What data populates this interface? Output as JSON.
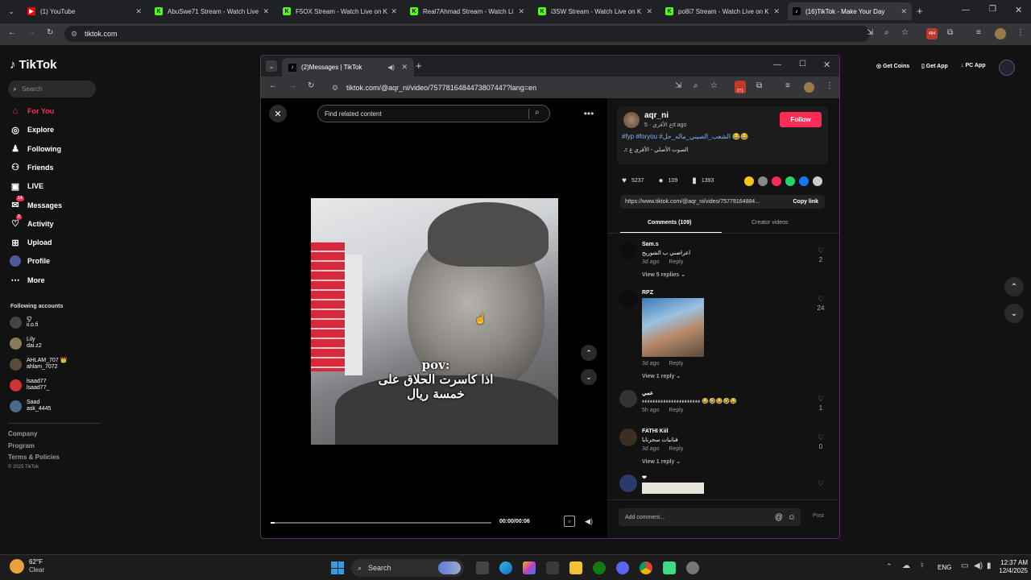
{
  "browser": {
    "tabs": [
      {
        "label": "(1) YouTube",
        "color": "#ff0000",
        "glyph": "▶"
      },
      {
        "label": "AbuSwe71 Stream - Watch Live",
        "color": "#53fc18",
        "glyph": "K"
      },
      {
        "label": "F5OX Stream - Watch Live on K",
        "color": "#53fc18",
        "glyph": "K"
      },
      {
        "label": "Real7Ahmad Stream - Watch Li",
        "color": "#53fc18",
        "glyph": "K"
      },
      {
        "label": "i3SW Stream - Watch Live on K",
        "color": "#53fc18",
        "glyph": "K"
      },
      {
        "label": "po8i7 Stream - Watch Live on K",
        "color": "#53fc18",
        "glyph": "K"
      },
      {
        "label": "(16)TikTok - Make Your Day",
        "color": "#000000",
        "glyph": "♪"
      }
    ],
    "url": "tiktok.com",
    "extension_badge": "484"
  },
  "tiktok": {
    "logo": "TikTok",
    "search_placeholder": "Search",
    "nav": [
      {
        "label": "For You",
        "icon": "home-icon",
        "active": true
      },
      {
        "label": "Explore",
        "icon": "compass-icon"
      },
      {
        "label": "Following",
        "icon": "following-icon"
      },
      {
        "label": "Friends",
        "icon": "friends-icon"
      },
      {
        "label": "LIVE",
        "icon": "live-icon"
      },
      {
        "label": "Messages",
        "icon": "messages-icon",
        "badge": "14"
      },
      {
        "label": "Activity",
        "icon": "activity-icon",
        "badge": "2"
      },
      {
        "label": "Upload",
        "icon": "upload-icon"
      },
      {
        "label": "Profile",
        "icon": "profile-icon"
      },
      {
        "label": "More",
        "icon": "more-icon"
      }
    ],
    "following_title": "Following accounts",
    "accounts": [
      {
        "name": "ꨄ︎",
        "handle": "ii.o.fi",
        "color": "#444"
      },
      {
        "name": "Lily",
        "handle": "dai.z2",
        "color": "#8a7b5a"
      },
      {
        "name": "AHLAM_707 👑",
        "handle": "ahlam_7072",
        "color": "#5a4a3a"
      },
      {
        "name": "lsaad77",
        "handle": "lsaad77_",
        "color": "#c33"
      },
      {
        "name": "Saad",
        "handle": "ask_4445",
        "color": "#4a6a8a"
      }
    ],
    "footer": [
      "Company",
      "Program",
      "Terms & Policies"
    ],
    "copyright": "© 2025 TikTok",
    "right_header": [
      "Get Coins",
      "Get App",
      "PC App"
    ]
  },
  "inner_window": {
    "tab_label": "(2)Messages | TikTok",
    "url": "tiktok.com/@aqr_ni/video/7577816484473807447?lang=en",
    "extension_badge": "271",
    "search_placeholder": "Find related content",
    "video": {
      "caption_line1": "pov:",
      "caption_line2": "اذا كاسرت الحلاق على",
      "caption_line3": "خمسة ريال",
      "time": "00:00/00:06",
      "progress": 0.02
    },
    "author": {
      "username": "aqr_ni",
      "subline": "ع الأقري · 5d ago",
      "follow_label": "Follow",
      "description": "#fyp #foryou #الشعب_الصيني_ماله_حل 😂😂",
      "sound": "♫ الصوت الأصلي - الأقري ع"
    },
    "stats": {
      "likes": "5237",
      "comments": "109",
      "saves": "1393"
    },
    "share_icons": [
      "#f5c518",
      "#888888",
      "#fe2c55",
      "#25d366",
      "#1877f2",
      "#cccccc"
    ],
    "link": "https://www.tiktok.com/@aqr_ni/video/75778164884...",
    "copy_link": "Copy link",
    "tabs": [
      "Comments (109)",
      "Creator videos"
    ],
    "comments": [
      {
        "user": "Sam.s",
        "text": "اعراضني ب الشوريح",
        "time": "3d ago",
        "reply": "Reply",
        "likes": "2",
        "replies": "View 5 replies",
        "has_image": false
      },
      {
        "user": "RPZ",
        "text": "",
        "time": "3d ago",
        "reply": "Reply",
        "likes": "24",
        "replies": "View 1 reply",
        "has_image": true
      },
      {
        "user": "عمي",
        "text": "ءءءءءءءءءءءءءءءءءءءءءء 😂🤣😂🤣😂",
        "time": "5h ago",
        "reply": "Reply",
        "likes": "1",
        "replies": "",
        "has_image": false
      },
      {
        "user": "FATHI Kiil",
        "text": "فنانيات سحرنايا",
        "time": "3d ago",
        "reply": "Reply",
        "likes": "0",
        "replies": "View 1 reply",
        "has_image": false
      },
      {
        "user": "❤",
        "text": "",
        "time": "",
        "reply": "",
        "likes": "",
        "replies": "",
        "has_image": false
      }
    ],
    "add_comment_placeholder": "Add comment...",
    "post_label": "Post"
  },
  "taskbar": {
    "weather_temp": "62°F",
    "weather_desc": "Clear",
    "search_label": "Search",
    "lang": "ENG",
    "time": "12:37 AM",
    "date": "12/4/2025"
  }
}
